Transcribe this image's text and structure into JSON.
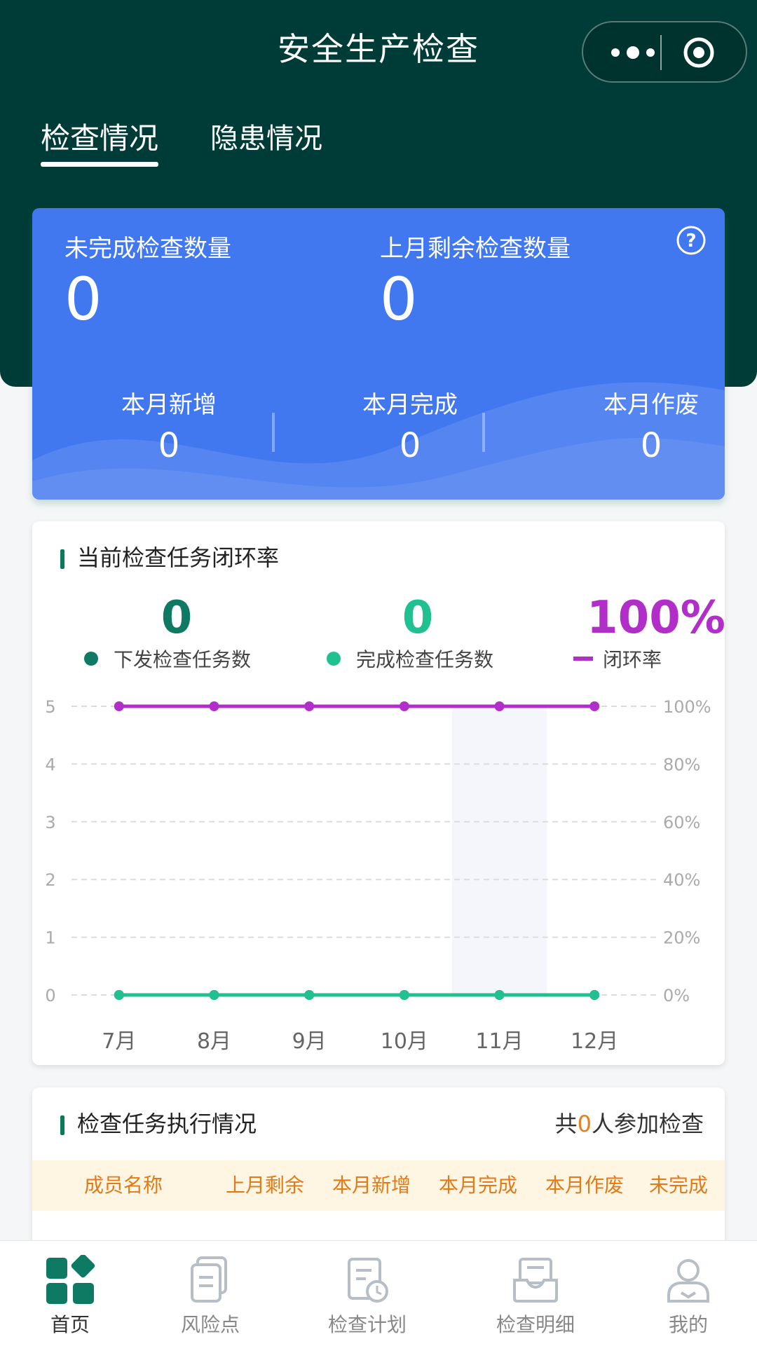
{
  "header": {
    "title": "安全生产检查",
    "capsule": {
      "more_icon": "more-dots-icon",
      "close_icon": "target-icon"
    }
  },
  "tabs": [
    {
      "label": "检查情况",
      "active": true
    },
    {
      "label": "隐患情况",
      "active": false
    }
  ],
  "summary": {
    "unfinished_label": "未完成检查数量",
    "unfinished_value": "0",
    "last_month_label": "上月剩余检查数量",
    "last_month_value": "0",
    "help_icon": "question-circle-icon",
    "stats": [
      {
        "label": "本月新增",
        "value": "0"
      },
      {
        "label": "本月完成",
        "value": "0"
      },
      {
        "label": "本月作废",
        "value": "0"
      }
    ]
  },
  "closure": {
    "title": "当前检查任务闭环率",
    "metrics": [
      {
        "value": "0",
        "label": "下发检查任务数",
        "color": "#0f7a63"
      },
      {
        "value": "0",
        "label": "完成检查任务数",
        "color": "#20c090"
      },
      {
        "value": "100%",
        "label": "闭环率",
        "color": "#b12ec8"
      }
    ]
  },
  "chart_data": {
    "type": "line",
    "categories": [
      "7月",
      "8月",
      "9月",
      "10月",
      "11月",
      "12月"
    ],
    "series": [
      {
        "name": "下发检查任务数",
        "axis": "left",
        "values": [
          0,
          0,
          0,
          0,
          0,
          0
        ],
        "color": "#0f7a63"
      },
      {
        "name": "完成检查任务数",
        "axis": "left",
        "values": [
          0,
          0,
          0,
          0,
          0,
          0
        ],
        "color": "#20c090"
      },
      {
        "name": "闭环率",
        "axis": "right",
        "values": [
          100,
          100,
          100,
          100,
          100,
          100
        ],
        "color": "#b12ec8"
      }
    ],
    "y_left": {
      "ylim": [
        0,
        5
      ],
      "ticks": [
        "0",
        "1",
        "2",
        "3",
        "4",
        "5"
      ]
    },
    "y_right": {
      "ylim": [
        0,
        100
      ],
      "ticks": [
        "0%",
        "20%",
        "40%",
        "60%",
        "80%",
        "100%"
      ]
    },
    "grid": "dashed-horizontal",
    "highlight_category": "11月"
  },
  "execution": {
    "title": "检查任务执行情况",
    "summary_prefix": "共",
    "summary_count": "0",
    "summary_suffix": "人参加检查",
    "columns": [
      "成员名称",
      "上月剩余",
      "本月新增",
      "本月完成",
      "本月作废",
      "未完成"
    ]
  },
  "bottom_nav": [
    {
      "label": "首页",
      "icon": "home-grid-icon",
      "active": true
    },
    {
      "label": "风险点",
      "icon": "document-icon",
      "active": false
    },
    {
      "label": "检查计划",
      "icon": "schedule-icon",
      "active": false
    },
    {
      "label": "检查明细",
      "icon": "tray-detail-icon",
      "active": false
    },
    {
      "label": "我的",
      "icon": "user-icon",
      "active": false
    }
  ],
  "colors": {
    "header_bg": "#003c37",
    "card_blue": "#4278ef",
    "accent_orange": "#e07b18",
    "brand_green": "#0f7a63"
  }
}
